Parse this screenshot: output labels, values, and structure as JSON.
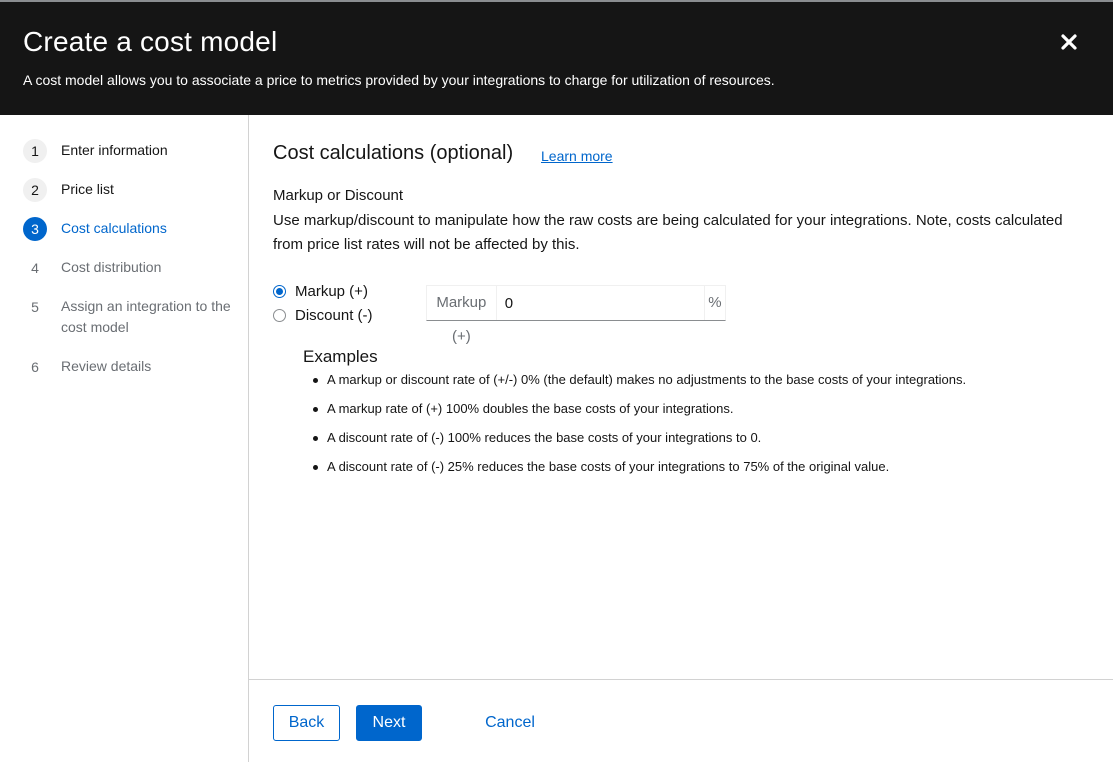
{
  "header": {
    "title": "Create a cost model",
    "description": "A cost model allows you to associate a price to metrics provided by your integrations to charge for utilization of resources.",
    "close_icon": "close-icon"
  },
  "wizard_nav": {
    "steps": [
      {
        "number": "1",
        "label": "Enter information",
        "state": "done"
      },
      {
        "number": "2",
        "label": "Price list",
        "state": "done"
      },
      {
        "number": "3",
        "label": "Cost calculations",
        "state": "active"
      },
      {
        "number": "4",
        "label": "Cost distribution",
        "state": "pending"
      },
      {
        "number": "5",
        "label": "Assign an integration to the cost model",
        "state": "pending"
      },
      {
        "number": "6",
        "label": "Review details",
        "state": "pending"
      }
    ]
  },
  "main": {
    "title": "Cost calculations (optional)",
    "learn_more": "Learn more",
    "subtitle": "Markup or Discount",
    "description": "Use markup/discount to manipulate how the raw costs are being calculated for your integrations. Note, costs calculated from price list rates will not be affected by this.",
    "radios": [
      {
        "label": "Markup (+)",
        "checked": true
      },
      {
        "label": "Discount (-)",
        "checked": false
      }
    ],
    "input": {
      "prefix": "Markup (+)",
      "value": "0",
      "suffix": "%"
    },
    "examples_title": "Examples",
    "examples": [
      "A markup or discount rate of (+/-) 0% (the default) makes no adjustments to the base costs of your integrations.",
      "A markup rate of (+) 100% doubles the base costs of your integrations.",
      "A discount rate of (-) 100% reduces the base costs of your integrations to 0.",
      "A discount rate of (-) 25% reduces the base costs of your integrations to 75% of the original value."
    ]
  },
  "footer": {
    "back": "Back",
    "next": "Next",
    "cancel": "Cancel"
  },
  "colors": {
    "accent": "#0066cc",
    "header_bg": "#151515"
  }
}
